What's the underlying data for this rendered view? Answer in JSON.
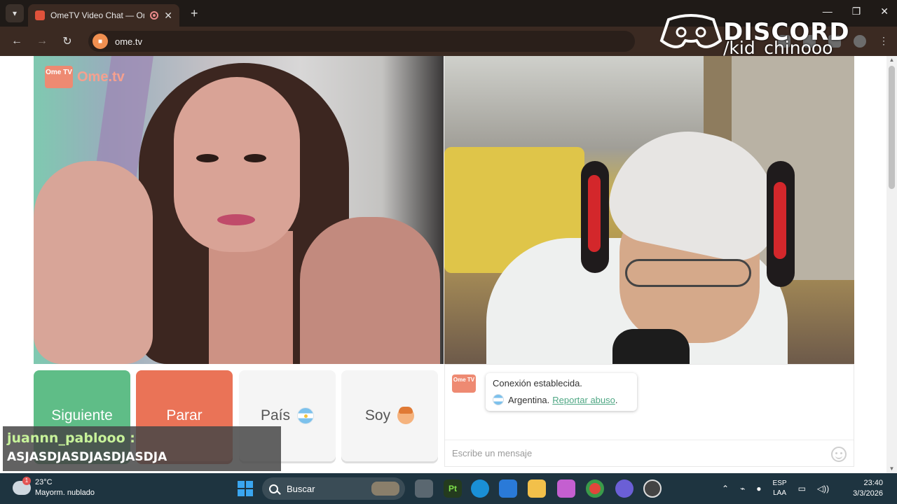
{
  "browser": {
    "tab_title": "OmeTV Video Chat — Ome",
    "url": "ome.tv",
    "accent": "#3b2a22"
  },
  "overlay": {
    "brand": "DISCORD",
    "user": "/kid_chinooo"
  },
  "video": {
    "logo_badge": "Ome TV",
    "logo_text": "Ome.tv"
  },
  "controls": {
    "next_label": "Siguiente",
    "stop_label": "Parar",
    "country_label": "País",
    "gender_label": "Soy",
    "next_color": "#5fbd87",
    "stop_color": "#ea7357"
  },
  "chat": {
    "logo_badge": "Ome TV",
    "status": "Conexión establecida.",
    "country": "Argentina.",
    "report_link": "Reportar abuso",
    "report_suffix": ".",
    "placeholder": "Escribe un mensaje"
  },
  "stream_chat": {
    "user": "juannn_pablooo :",
    "message": "ASJASDJASDJASDJASDJA"
  },
  "taskbar": {
    "weather_temp": "23°C",
    "weather_desc": "Mayorm. nublado",
    "weather_badge": "1",
    "search_label": "Buscar",
    "lang_top": "ESP",
    "lang_bottom": "LAA",
    "time": "23:40",
    "date": "3/3/2026"
  }
}
